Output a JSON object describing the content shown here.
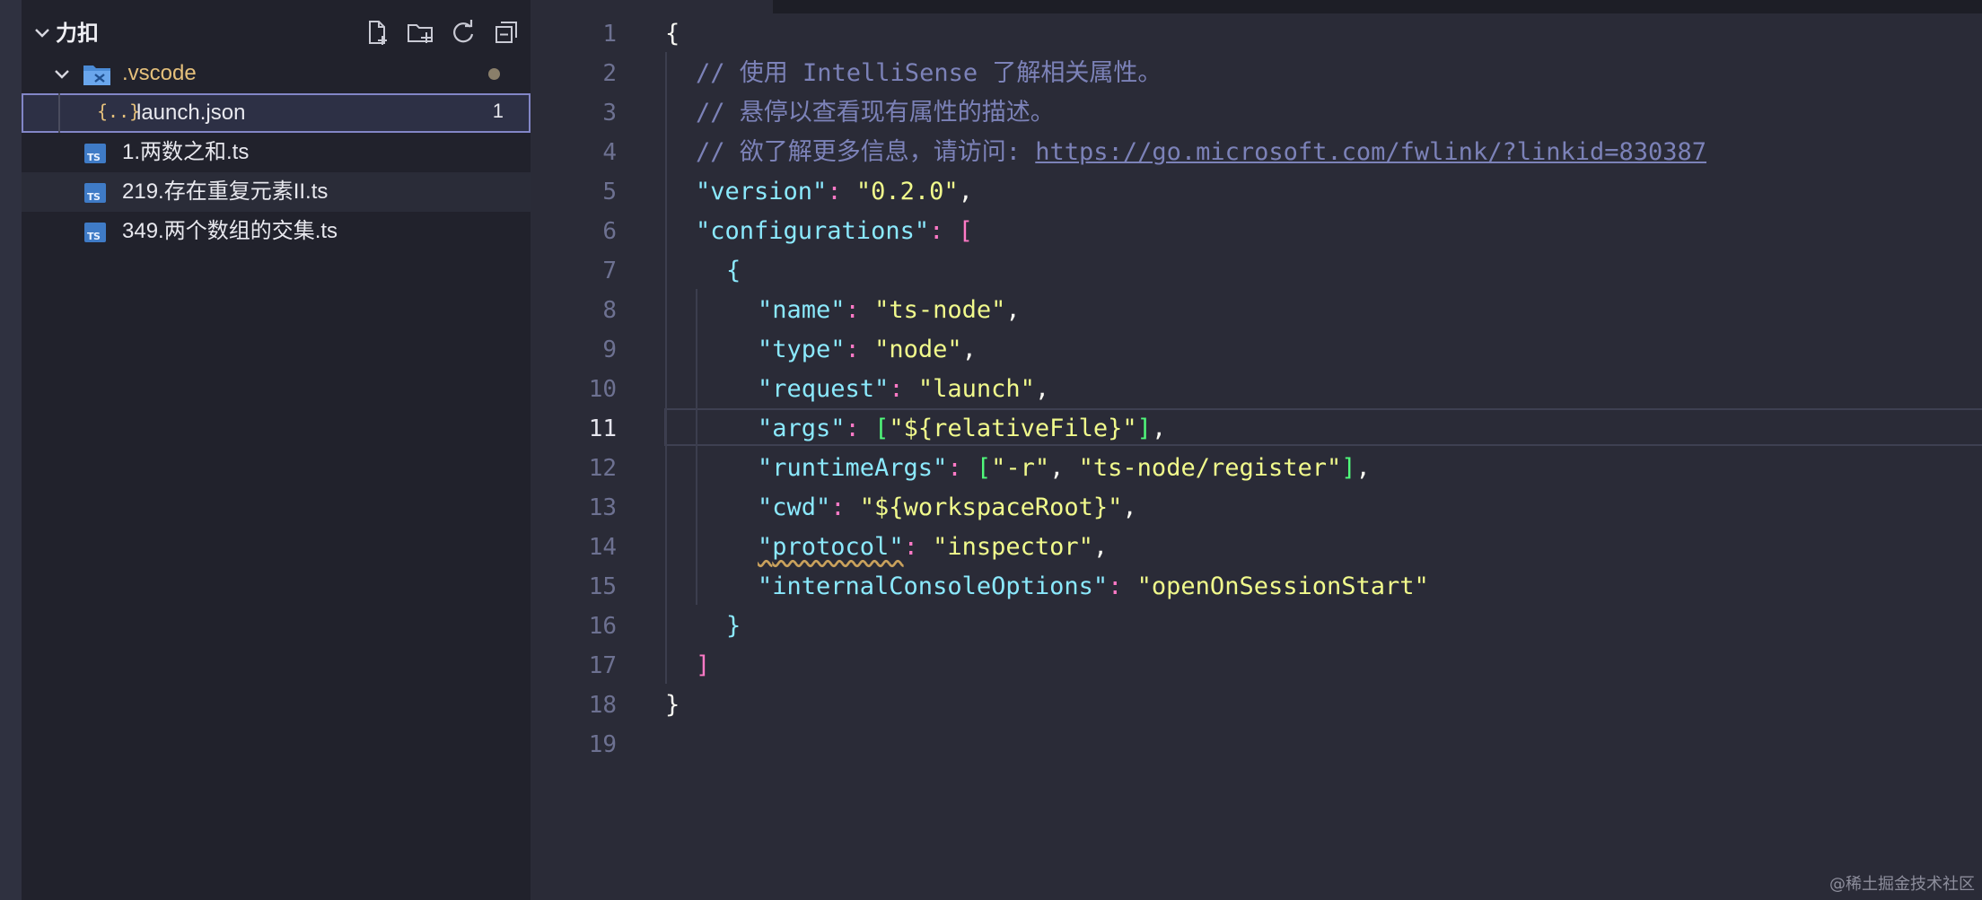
{
  "explorer": {
    "root_label": "力扣",
    "folder": {
      "label": ".vscode"
    },
    "files": [
      {
        "label": "launch.json",
        "badge": "1"
      },
      {
        "label": "1.两数之和.ts",
        "icon": "TS"
      },
      {
        "label": "219.存在重复元素II.ts",
        "icon": "TS"
      },
      {
        "label": "349.两个数组的交集.ts",
        "icon": "TS"
      }
    ],
    "json_icon_text": "{..}"
  },
  "editor": {
    "line_numbers": [
      "1",
      "2",
      "3",
      "4",
      "5",
      "6",
      "7",
      "8",
      "9",
      "10",
      "11",
      "12",
      "13",
      "14",
      "15",
      "16",
      "17",
      "18",
      "19"
    ],
    "active_line": "11",
    "tokens": {
      "l1_open": "{",
      "l2_comment": "// 使用 IntelliSense 了解相关属性。",
      "l3_comment": "// 悬停以查看现有属性的描述。",
      "l4_comment": "// 欲了解更多信息，请访问: ",
      "l4_url": "https://go.microsoft.com/fwlink/?linkid=830387",
      "version_key": "\"version\"",
      "version_val": "\"0.2.0\"",
      "configurations_key": "\"configurations\"",
      "name_key": "\"name\"",
      "name_val": "\"ts-node\"",
      "type_key": "\"type\"",
      "type_val": "\"node\"",
      "request_key": "\"request\"",
      "request_val": "\"launch\"",
      "args_key": "\"args\"",
      "args_val": "\"${relativeFile}\"",
      "runtimeArgs_key": "\"runtimeArgs\"",
      "runtimeArgs_val1": "\"-r\"",
      "runtimeArgs_val2": "\"ts-node/register\"",
      "cwd_key": "\"cwd\"",
      "cwd_val": "\"${workspaceRoot}\"",
      "protocol_key_q1": "\"",
      "protocol_key_word": "protocol",
      "protocol_key_q2": "\"",
      "protocol_val": "\"inspector\"",
      "ico_key": "\"internalConsoleOptions\"",
      "ico_val": "\"openOnSessionStart\""
    }
  },
  "watermark": "@稀土掘金技术社区",
  "colors": {
    "sidebar_bg": "#21222c",
    "editor_bg": "#2a2b37",
    "selection_outline": "#8286c7",
    "ts_icon": "#3f7bc6",
    "folder_label": "#e5c07b",
    "json_icon": "#e5c07b"
  }
}
